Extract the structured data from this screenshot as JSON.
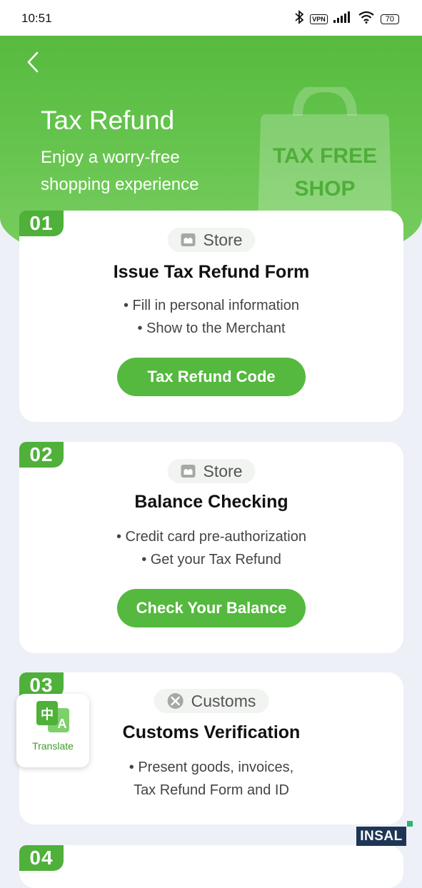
{
  "status_bar": {
    "time": "10:51",
    "vpn": "VPN",
    "battery": "70"
  },
  "header": {
    "title": "Tax Refund",
    "subtitle": "Enjoy a worry-free shopping experience",
    "bag_line1": "TAX FREE",
    "bag_line2": "SHOP"
  },
  "steps": [
    {
      "number": "01",
      "tag": "Store",
      "tag_icon": "store-icon",
      "title": "Issue Tax Refund Form",
      "bullets": [
        "• Fill in personal information",
        "• Show to the Merchant"
      ],
      "button": "Tax Refund Code"
    },
    {
      "number": "02",
      "tag": "Store",
      "tag_icon": "store-icon",
      "title": "Balance Checking",
      "bullets": [
        "• Credit card pre-authorization",
        "• Get your Tax Refund"
      ],
      "button": "Check Your Balance"
    },
    {
      "number": "03",
      "tag": "Customs",
      "tag_icon": "customs-icon",
      "title": "Customs Verification",
      "bullets": [
        "• Present goods, invoices,",
        "Tax Refund Form and ID"
      ]
    },
    {
      "number": "04"
    }
  ],
  "translate": {
    "label": "Translate",
    "icon": "translate-icon",
    "glyph_cn": "中",
    "glyph_en": "A"
  },
  "watermark": "INSAL",
  "colors": {
    "brand_green": "#55b83f",
    "badge_green": "#4fb03a",
    "page_bg": "#eef0f7"
  }
}
